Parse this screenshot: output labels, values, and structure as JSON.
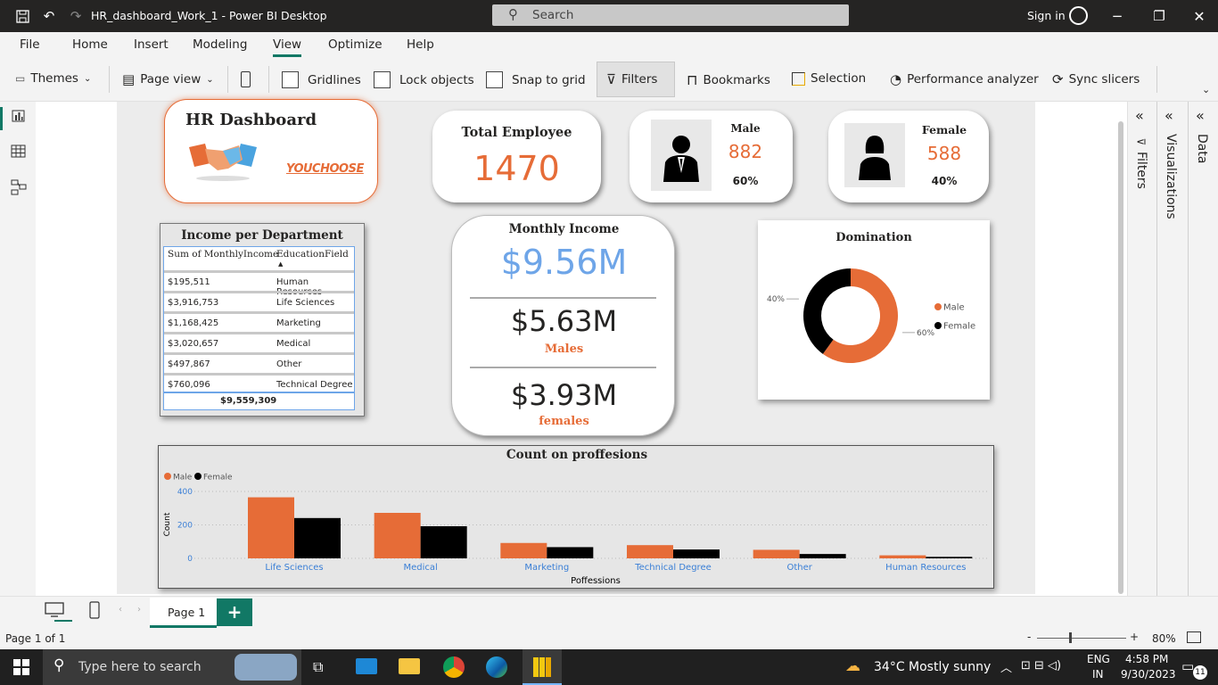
{
  "window": {
    "title": "HR_dashboard_Work_1 - Power BI Desktop",
    "search_placeholder": "Search",
    "sign_in": "Sign in"
  },
  "menu": [
    "File",
    "Home",
    "Insert",
    "Modeling",
    "View",
    "Optimize",
    "Help"
  ],
  "ribbon": {
    "themes": "Themes",
    "page_view": "Page view",
    "gridlines": "Gridlines",
    "lock_objects": "Lock objects",
    "snap_to_grid": "Snap to grid",
    "filters": "Filters",
    "bookmarks": "Bookmarks",
    "selection": "Selection",
    "performance_analyzer": "Performance analyzer",
    "sync_slicers": "Sync slicers"
  },
  "panes": {
    "filters": "Filters",
    "visualizations": "Visualizations",
    "data": "Data"
  },
  "dashboard": {
    "title": "HR Dashboard",
    "logo_text": "YOUCHOOSE",
    "total_employee": {
      "label": "Total Employee",
      "value": "1470"
    },
    "male": {
      "label": "Male",
      "value": "882",
      "pct": "60%"
    },
    "female": {
      "label": "Female",
      "value": "588",
      "pct": "40%"
    },
    "monthly_income": {
      "label": "Monthly Income",
      "total": "$9.56M",
      "males_value": "$5.63M",
      "males_label": "Males",
      "females_value": "$3.93M",
      "females_label": "females"
    },
    "income_table": {
      "title": "Income per Department",
      "col1": "Sum of MonthlyIncome",
      "col2": "EducationField",
      "rows": [
        [
          "$195,511",
          "Human Resources"
        ],
        [
          "$3,916,753",
          "Life Sciences"
        ],
        [
          "$1,168,425",
          "Marketing"
        ],
        [
          "$3,020,657",
          "Medical"
        ],
        [
          "$497,867",
          "Other"
        ],
        [
          "$760,096",
          "Technical Degree"
        ]
      ],
      "total": "$9,559,309"
    }
  },
  "chart_data": [
    {
      "type": "pie",
      "title": "Domination",
      "categories": [
        "Male",
        "Female"
      ],
      "values": [
        60,
        40
      ],
      "labels": [
        "60%",
        "40%"
      ],
      "colors": [
        "#e66c37",
        "#000000"
      ],
      "legend": "right",
      "donut": true
    },
    {
      "type": "bar",
      "title": "Count on proffesions",
      "xlabel": "Poffessions",
      "ylabel": "Count",
      "ylim": [
        0,
        400
      ],
      "yticks": [
        0,
        200,
        400
      ],
      "categories": [
        "Life Sciences",
        "Medical",
        "Marketing",
        "Technical Degree",
        "Other",
        "Human Resources"
      ],
      "series": [
        {
          "name": "Male",
          "color": "#e66c37",
          "values": [
            365,
            272,
            92,
            79,
            51,
            18
          ]
        },
        {
          "name": "Female",
          "color": "#000000",
          "values": [
            241,
            192,
            67,
            53,
            26,
            9
          ]
        }
      ],
      "legend": "top-left",
      "grid": true
    }
  ],
  "bottom": {
    "page_tab": "Page 1",
    "status": "Page 1 of 1",
    "zoom": "80%"
  },
  "taskbar": {
    "search_placeholder": "Type here to search",
    "weather": "34°C  Mostly sunny",
    "lang1": "ENG",
    "lang2": "IN",
    "time": "4:58 PM",
    "date": "9/30/2023",
    "notif": "11"
  },
  "colors": {
    "accent": "#e66c37",
    "blue": "#6ea5e8",
    "teal": "#117865"
  }
}
